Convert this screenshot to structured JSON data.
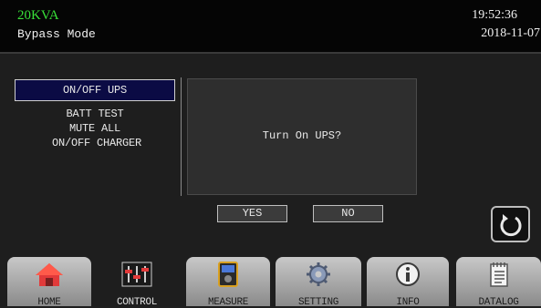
{
  "header": {
    "model": "20KVA",
    "mode": "Bypass Mode",
    "time": "19:52:36",
    "date": "2018-11-07"
  },
  "menu": {
    "items": [
      {
        "label": "ON/OFF UPS",
        "selected": true
      },
      {
        "label": "BATT TEST"
      },
      {
        "label": "MUTE ALL"
      },
      {
        "label": "ON/OFF CHARGER"
      }
    ]
  },
  "dialog": {
    "message": "Turn On UPS?",
    "yes_label": "YES",
    "no_label": "NO"
  },
  "back_button": {
    "icon": "refresh-icon"
  },
  "tabs": [
    {
      "label": "HOME",
      "icon": "home-icon"
    },
    {
      "label": "CONTROL",
      "icon": "sliders-icon"
    },
    {
      "label": "MEASURE",
      "icon": "meter-icon"
    },
    {
      "label": "SETTING",
      "icon": "gear-icon"
    },
    {
      "label": "INFO",
      "icon": "info-icon"
    },
    {
      "label": "DATALOG",
      "icon": "notebook-icon"
    }
  ],
  "colors": {
    "model_text": "#39e039",
    "selected_item_bg": "#0b0b44",
    "background": "#1e1e1e"
  }
}
